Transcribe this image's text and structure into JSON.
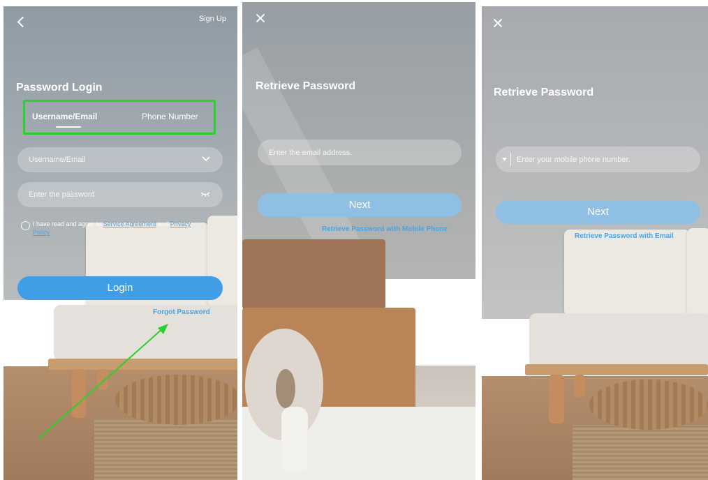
{
  "login": {
    "back_icon": "chevron-left-icon",
    "signup_label": "Sign Up",
    "title": "Password Login",
    "tabs": [
      {
        "label": "Username/Email",
        "active": true
      },
      {
        "label": "Phone Number",
        "active": false
      }
    ],
    "username_placeholder": "Username/Email",
    "password_placeholder": "Enter the password",
    "agree_prefix": "I have read and agree to",
    "service_agreement": "Service Agreement",
    "agree_and": "and",
    "privacy_policy": "Privacy Policy",
    "login_label": "Login",
    "forgot_label": "Forgot Password",
    "highlight_color": "#2bd12b",
    "arrow_color": "#2bd12b"
  },
  "retrieve_email": {
    "close_icon": "close-icon",
    "title": "Retrieve Password",
    "email_placeholder": "Enter the email address.",
    "next_label": "Next",
    "alt_link": "Retrieve Password with Mobile Phone"
  },
  "retrieve_phone": {
    "close_icon": "close-icon",
    "title": "Retrieve Password",
    "phone_placeholder": "Enter your mobile phone number.",
    "next_label": "Next",
    "alt_link": "Retrieve Password with Email"
  },
  "colors": {
    "login_button": "#3f9ee6",
    "next_button": "#8fc0e3",
    "link": "#4ba3e3"
  }
}
